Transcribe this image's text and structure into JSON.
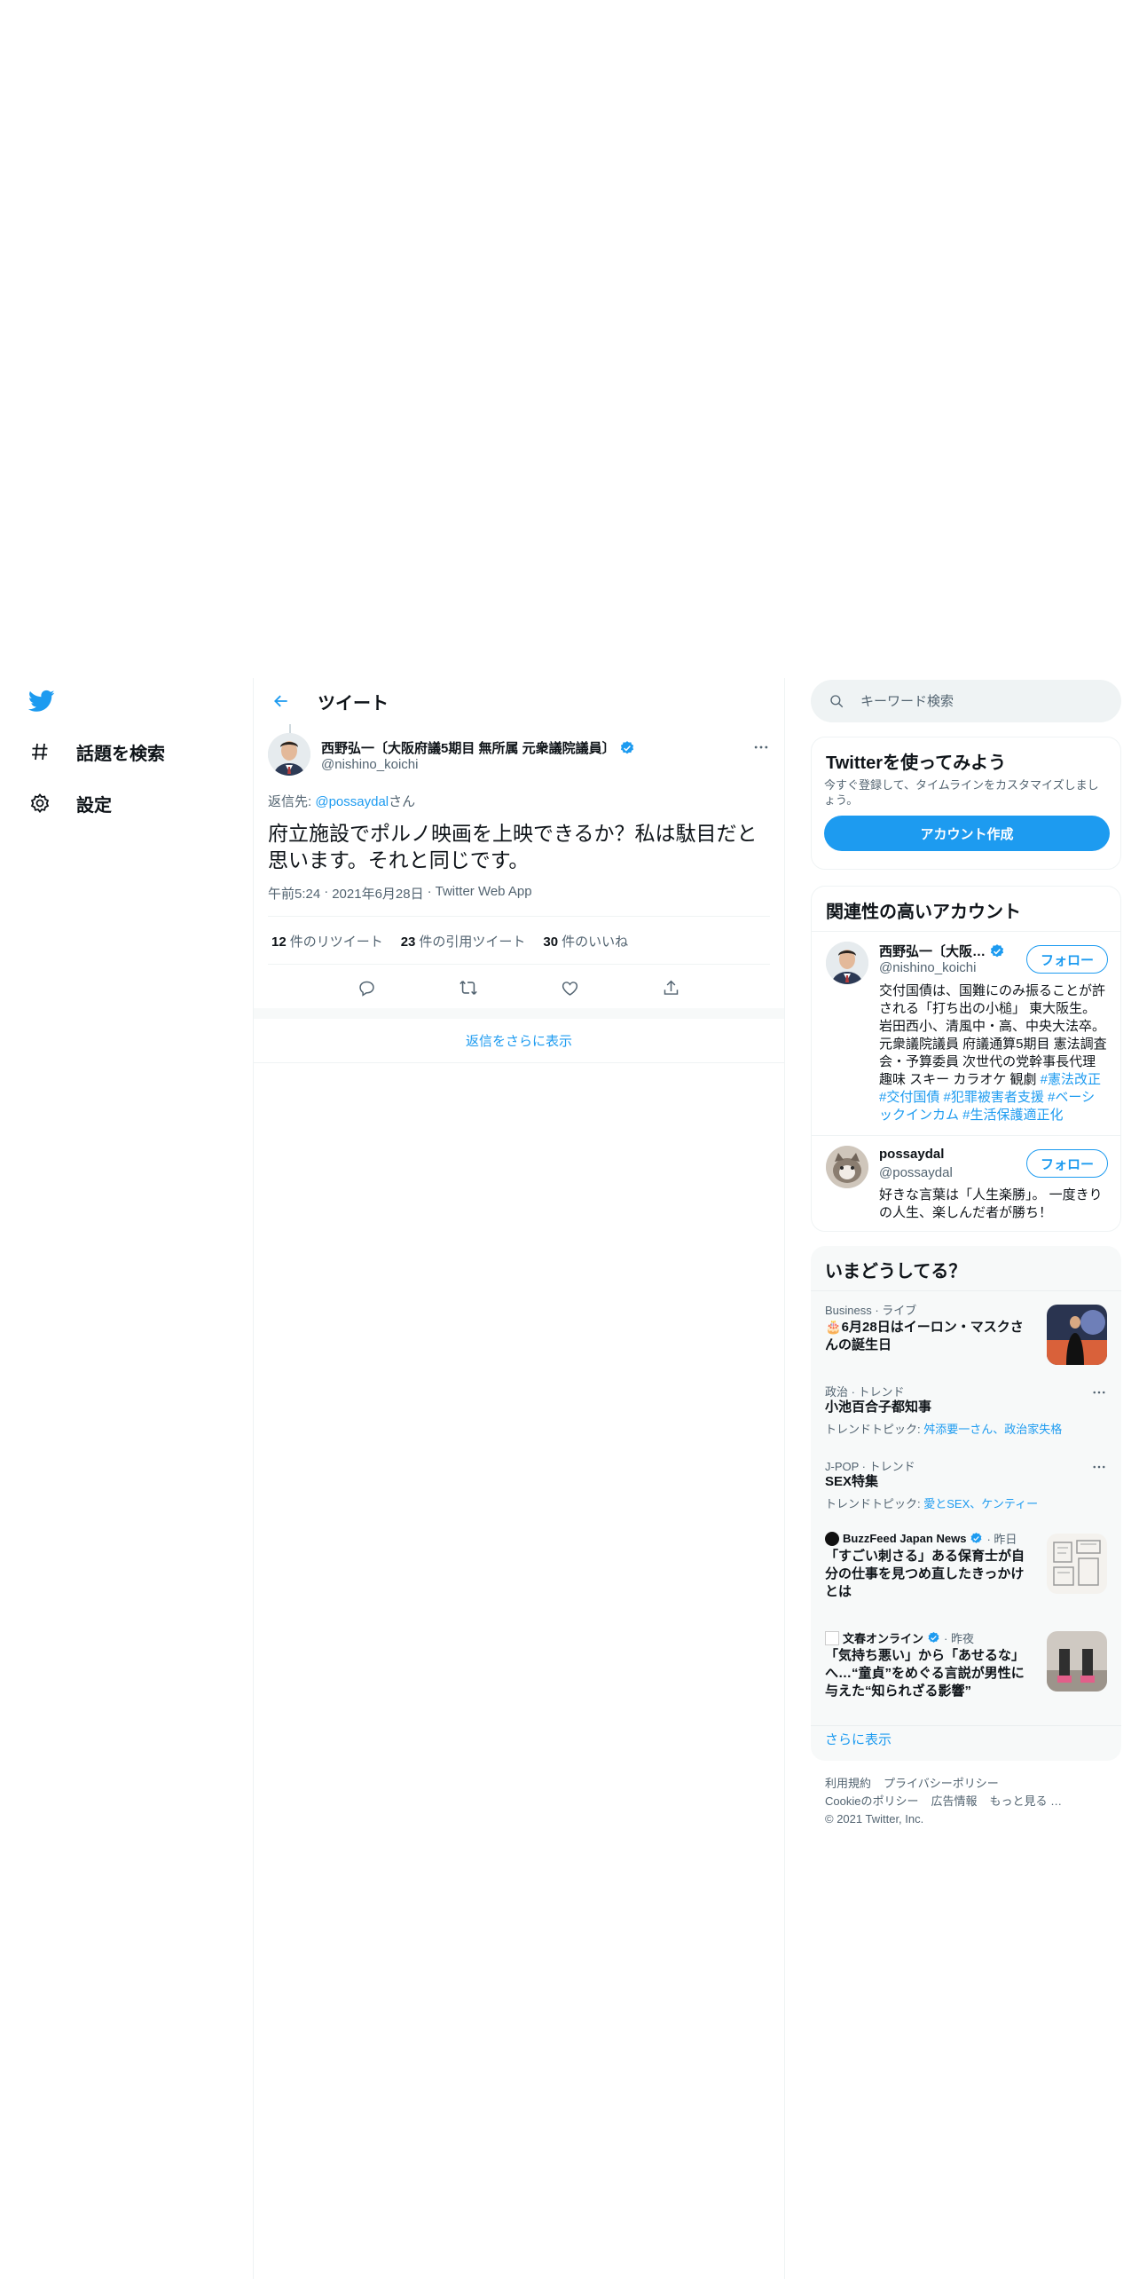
{
  "nav": {
    "items": [
      {
        "label": "話題を検索",
        "icon": "hashtag-icon"
      },
      {
        "label": "設定",
        "icon": "gear-icon"
      }
    ]
  },
  "header": {
    "title": "ツイート"
  },
  "tweet": {
    "author_name": "西野弘一〔大阪府議5期目 無所属 元衆議院議員〕",
    "author_handle": "@nishino_koichi",
    "reply_prefix": "返信先: ",
    "reply_handle": "@possaydal",
    "reply_suffix": "さん",
    "text": "府立施設でポルノ映画を上映できるか？私は駄目だと思います。それと同じです。",
    "time": "午前5:24",
    "date": "2021年6月28日",
    "source": "Twitter Web App",
    "retweets_count": "12",
    "retweets_label": "件のリツイート",
    "quotes_count": "23",
    "quotes_label": "件の引用ツイート",
    "likes_count": "30",
    "likes_label": "件のいいね",
    "show_more_replies": "返信をさらに表示"
  },
  "search": {
    "placeholder": "キーワード検索"
  },
  "signup": {
    "title": "Twitterを使ってみよう",
    "desc": "今すぐ登録して、タイムラインをカスタマイズしましょう。",
    "button": "アカウント作成"
  },
  "related": {
    "title": "関連性の高いアカウント",
    "accounts": [
      {
        "name": "西野弘一〔大阪…",
        "handle": "@nishino_koichi",
        "follow": "フォロー",
        "bio": "交付国債は、国難にのみ振ることが許される「打ち出の小槌」 東大阪生。岩田西小、清風中・高、中央大法卒。元衆議院議員 府議通算5期目 憲法調査会・予算委員 次世代の党幹事長代理 趣味 スキー カラオケ 観劇 ",
        "tags": "#憲法改正 #交付国債 #犯罪被害者支援 #ベーシックインカム #生活保護適正化"
      },
      {
        "name": "possaydal",
        "handle": "@possaydal",
        "follow": "フォロー",
        "bio": "好きな言葉は「人生楽勝」。 一度きりの人生、楽しんだ者が勝ち！"
      }
    ]
  },
  "trends": {
    "title": "いまどうしてる？",
    "items": [
      {
        "meta": "Business · ライブ",
        "title": "🎂6月28日はイーロン・マスクさんの誕生日"
      },
      {
        "meta": "政治 · トレンド",
        "title": "小池百合子都知事",
        "topics_label": "トレンドトピック: ",
        "topics": "舛添要一さん、政治家失格"
      },
      {
        "meta": "J-POP · トレンド",
        "title": "SEX特集",
        "topics_label": "トレンドトピック: ",
        "topics": "愛とSEX、ケンティー"
      },
      {
        "source": "BuzzFeed Japan News",
        "time": "· 昨日",
        "title": "「すごい刺さる」ある保育士が自分の仕事を見つめ直したきっかけとは"
      },
      {
        "source": "文春オンライン",
        "time": "· 昨夜",
        "title": "「気持ち悪い」から「あせるな」へ…“童貞”をめぐる言説が男性に与えた“知られざる影響”"
      }
    ],
    "show_more": "さらに表示"
  },
  "footer": {
    "links": [
      "利用規約",
      "プライバシーポリシー",
      "Cookieのポリシー",
      "広告情報",
      "もっと見る …"
    ],
    "copyright": "© 2021 Twitter, Inc."
  },
  "colors": {
    "accent": "#1d9bf0",
    "text": "#0f1419",
    "muted": "#536471",
    "border": "#eff3f4"
  }
}
